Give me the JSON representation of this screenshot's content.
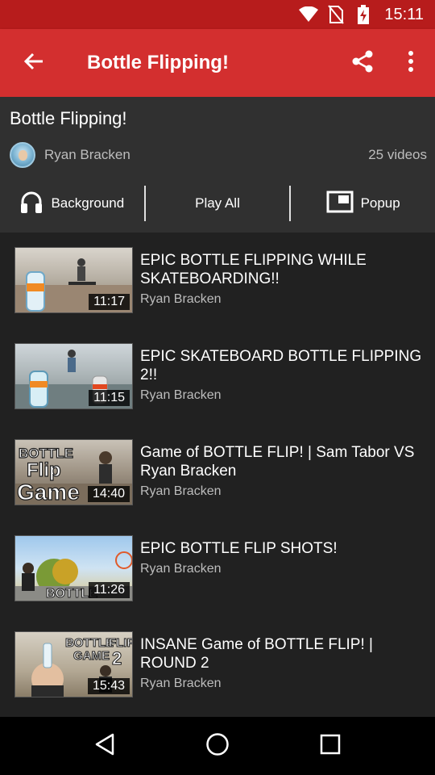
{
  "status_bar": {
    "time": "15:11",
    "icons": [
      "wifi-icon",
      "no-sim-icon",
      "battery-charging-icon"
    ]
  },
  "app_bar": {
    "title": "Bottle Flipping!",
    "back_icon": "arrow-back-icon",
    "share_icon": "share-icon",
    "menu_icon": "more-vert-icon"
  },
  "playlist": {
    "title": "Bottle Flipping!",
    "uploader": "Ryan Bracken",
    "video_count": "25 videos",
    "actions": {
      "background": "Background",
      "play_all": "Play All",
      "popup": "Popup"
    }
  },
  "videos": [
    {
      "title": "EPIC BOTTLE FLIPPING WHILE SKATEBOARDING!!",
      "uploader": "Ryan Bracken",
      "duration": "11:17"
    },
    {
      "title": "EPIC SKATEBOARD BOTTLE FLIPPING 2!!",
      "uploader": "Ryan Bracken",
      "duration": "11:15"
    },
    {
      "title": "Game of BOTTLE FLIP! | Sam Tabor VS Ryan Bracken",
      "uploader": "Ryan Bracken",
      "duration": "14:40",
      "thumb_text": [
        "BOTTLE",
        "Flip",
        "Game"
      ]
    },
    {
      "title": "EPIC BOTTLE FLIP SHOTS!",
      "uploader": "Ryan Bracken",
      "duration": "11:26",
      "thumb_text": [
        "BOTTLE"
      ]
    },
    {
      "title": "INSANE Game of BOTTLE FLIP! | ROUND 2",
      "uploader": "Ryan Bracken",
      "duration": "15:43",
      "thumb_text": [
        "BOTTLE",
        "FLIP",
        "GAME",
        "2"
      ]
    }
  ],
  "nav_bar": {
    "icons": [
      "back-triangle-icon",
      "home-circle-icon",
      "recents-square-icon"
    ]
  },
  "colors": {
    "status_bar": "#b71c1c",
    "app_bar": "#d32f2f",
    "header_bg": "#303030",
    "list_bg": "#212121"
  }
}
